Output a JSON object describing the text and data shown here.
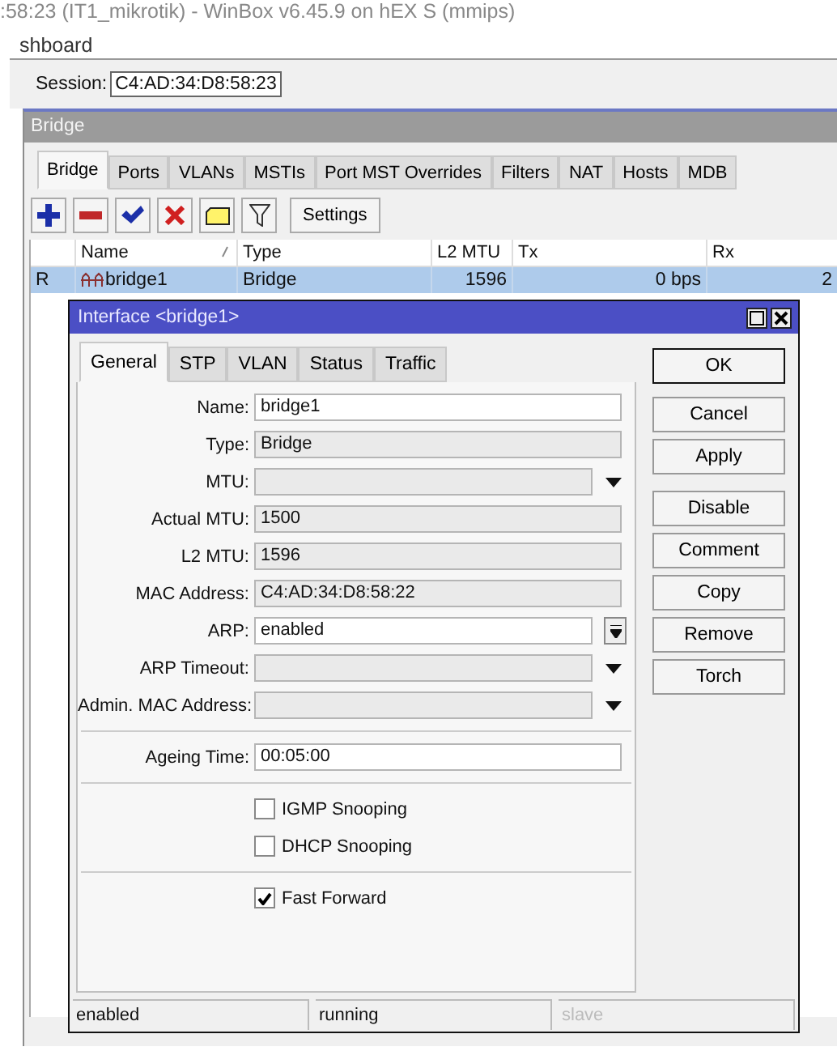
{
  "window": {
    "title": ":58:23 (IT1_mikrotik) - WinBox v6.45.9 on hEX S (mmips)"
  },
  "breadcrumb": "shboard",
  "session": {
    "label": "Session:",
    "value": "C4:AD:34:D8:58:23"
  },
  "bridge_window": {
    "title": "Bridge",
    "tabs": [
      {
        "label": "Bridge",
        "selected": true
      },
      {
        "label": "Ports",
        "selected": false
      },
      {
        "label": "VLANs",
        "selected": false
      },
      {
        "label": "MSTIs",
        "selected": false
      },
      {
        "label": "Port MST Overrides",
        "selected": false
      },
      {
        "label": "Filters",
        "selected": false
      },
      {
        "label": "NAT",
        "selected": false
      },
      {
        "label": "Hosts",
        "selected": false
      },
      {
        "label": "MDB",
        "selected": false
      }
    ],
    "toolbar": [
      {
        "kind": "add"
      },
      {
        "kind": "remove"
      },
      {
        "kind": "enable"
      },
      {
        "kind": "disable"
      },
      {
        "kind": "comment"
      },
      {
        "kind": "filter"
      },
      {
        "kind": "text",
        "label": "Settings"
      }
    ],
    "table": {
      "columns": [
        "",
        "Name",
        "Type",
        "L2 MTU",
        "Tx",
        "Rx"
      ],
      "rows": [
        {
          "cells": [
            "R",
            "bridge1",
            "Bridge",
            "1596",
            "0 bps",
            "2"
          ],
          "selected": true
        }
      ]
    }
  },
  "dialog": {
    "title": "Interface <bridge1>",
    "tabs": [
      {
        "label": "General",
        "selected": true
      },
      {
        "label": "STP",
        "selected": false
      },
      {
        "label": "VLAN",
        "selected": false
      },
      {
        "label": "Status",
        "selected": false
      },
      {
        "label": "Traffic",
        "selected": false
      }
    ],
    "sections": [
      [
        {
          "kind": "text",
          "label": "Name:",
          "value": "bridge1"
        },
        {
          "kind": "readonly",
          "label": "Type:",
          "value": "Bridge"
        },
        {
          "kind": "dropdown",
          "label": "MTU:"
        },
        {
          "kind": "readonly",
          "label": "Actual MTU:",
          "value": "1500"
        },
        {
          "kind": "readonly",
          "label": "L2 MTU:",
          "value": "1596"
        },
        {
          "kind": "readonly",
          "label": "MAC Address:",
          "value": "C4:AD:34:D8:58:22"
        },
        {
          "kind": "combo",
          "label": "ARP:",
          "value": "enabled"
        },
        {
          "kind": "dropdown",
          "label": "ARP Timeout:"
        },
        {
          "kind": "dropdown",
          "label": "Admin. MAC Address:"
        }
      ],
      [
        {
          "kind": "text",
          "label": "Ageing Time:",
          "value": "00:05:00"
        }
      ],
      [
        {
          "kind": "checkbox",
          "label": "IGMP Snooping",
          "checked": false
        },
        {
          "kind": "checkbox",
          "label": "DHCP Snooping",
          "checked": false
        }
      ],
      [
        {
          "kind": "checkbox",
          "label": "Fast Forward",
          "checked": true
        }
      ]
    ],
    "buttons": [
      {
        "label": "OK",
        "default": true
      },
      {
        "label": "Cancel",
        "default": false
      },
      {
        "label": "Apply",
        "default": false
      },
      {
        "label": "Disable",
        "default": false
      },
      {
        "label": "Comment",
        "default": false
      },
      {
        "label": "Copy",
        "default": false
      },
      {
        "label": "Remove",
        "default": false
      },
      {
        "label": "Torch",
        "default": false
      }
    ],
    "status_bar": [
      {
        "text": "enabled",
        "disabled": false
      },
      {
        "text": "running",
        "disabled": false
      },
      {
        "text": "slave",
        "disabled": true
      }
    ]
  }
}
